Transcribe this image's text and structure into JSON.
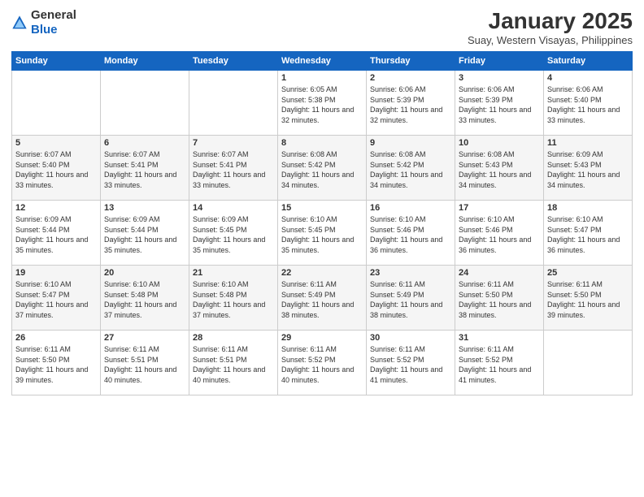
{
  "header": {
    "logo_general": "General",
    "logo_blue": "Blue",
    "month_title": "January 2025",
    "subtitle": "Suay, Western Visayas, Philippines"
  },
  "days_of_week": [
    "Sunday",
    "Monday",
    "Tuesday",
    "Wednesday",
    "Thursday",
    "Friday",
    "Saturday"
  ],
  "weeks": [
    [
      {
        "day": "",
        "sunrise": "",
        "sunset": "",
        "daylight": ""
      },
      {
        "day": "",
        "sunrise": "",
        "sunset": "",
        "daylight": ""
      },
      {
        "day": "",
        "sunrise": "",
        "sunset": "",
        "daylight": ""
      },
      {
        "day": "1",
        "sunrise": "Sunrise: 6:05 AM",
        "sunset": "Sunset: 5:38 PM",
        "daylight": "Daylight: 11 hours and 32 minutes."
      },
      {
        "day": "2",
        "sunrise": "Sunrise: 6:06 AM",
        "sunset": "Sunset: 5:39 PM",
        "daylight": "Daylight: 11 hours and 32 minutes."
      },
      {
        "day": "3",
        "sunrise": "Sunrise: 6:06 AM",
        "sunset": "Sunset: 5:39 PM",
        "daylight": "Daylight: 11 hours and 33 minutes."
      },
      {
        "day": "4",
        "sunrise": "Sunrise: 6:06 AM",
        "sunset": "Sunset: 5:40 PM",
        "daylight": "Daylight: 11 hours and 33 minutes."
      }
    ],
    [
      {
        "day": "5",
        "sunrise": "Sunrise: 6:07 AM",
        "sunset": "Sunset: 5:40 PM",
        "daylight": "Daylight: 11 hours and 33 minutes."
      },
      {
        "day": "6",
        "sunrise": "Sunrise: 6:07 AM",
        "sunset": "Sunset: 5:41 PM",
        "daylight": "Daylight: 11 hours and 33 minutes."
      },
      {
        "day": "7",
        "sunrise": "Sunrise: 6:07 AM",
        "sunset": "Sunset: 5:41 PM",
        "daylight": "Daylight: 11 hours and 33 minutes."
      },
      {
        "day": "8",
        "sunrise": "Sunrise: 6:08 AM",
        "sunset": "Sunset: 5:42 PM",
        "daylight": "Daylight: 11 hours and 34 minutes."
      },
      {
        "day": "9",
        "sunrise": "Sunrise: 6:08 AM",
        "sunset": "Sunset: 5:42 PM",
        "daylight": "Daylight: 11 hours and 34 minutes."
      },
      {
        "day": "10",
        "sunrise": "Sunrise: 6:08 AM",
        "sunset": "Sunset: 5:43 PM",
        "daylight": "Daylight: 11 hours and 34 minutes."
      },
      {
        "day": "11",
        "sunrise": "Sunrise: 6:09 AM",
        "sunset": "Sunset: 5:43 PM",
        "daylight": "Daylight: 11 hours and 34 minutes."
      }
    ],
    [
      {
        "day": "12",
        "sunrise": "Sunrise: 6:09 AM",
        "sunset": "Sunset: 5:44 PM",
        "daylight": "Daylight: 11 hours and 35 minutes."
      },
      {
        "day": "13",
        "sunrise": "Sunrise: 6:09 AM",
        "sunset": "Sunset: 5:44 PM",
        "daylight": "Daylight: 11 hours and 35 minutes."
      },
      {
        "day": "14",
        "sunrise": "Sunrise: 6:09 AM",
        "sunset": "Sunset: 5:45 PM",
        "daylight": "Daylight: 11 hours and 35 minutes."
      },
      {
        "day": "15",
        "sunrise": "Sunrise: 6:10 AM",
        "sunset": "Sunset: 5:45 PM",
        "daylight": "Daylight: 11 hours and 35 minutes."
      },
      {
        "day": "16",
        "sunrise": "Sunrise: 6:10 AM",
        "sunset": "Sunset: 5:46 PM",
        "daylight": "Daylight: 11 hours and 36 minutes."
      },
      {
        "day": "17",
        "sunrise": "Sunrise: 6:10 AM",
        "sunset": "Sunset: 5:46 PM",
        "daylight": "Daylight: 11 hours and 36 minutes."
      },
      {
        "day": "18",
        "sunrise": "Sunrise: 6:10 AM",
        "sunset": "Sunset: 5:47 PM",
        "daylight": "Daylight: 11 hours and 36 minutes."
      }
    ],
    [
      {
        "day": "19",
        "sunrise": "Sunrise: 6:10 AM",
        "sunset": "Sunset: 5:47 PM",
        "daylight": "Daylight: 11 hours and 37 minutes."
      },
      {
        "day": "20",
        "sunrise": "Sunrise: 6:10 AM",
        "sunset": "Sunset: 5:48 PM",
        "daylight": "Daylight: 11 hours and 37 minutes."
      },
      {
        "day": "21",
        "sunrise": "Sunrise: 6:10 AM",
        "sunset": "Sunset: 5:48 PM",
        "daylight": "Daylight: 11 hours and 37 minutes."
      },
      {
        "day": "22",
        "sunrise": "Sunrise: 6:11 AM",
        "sunset": "Sunset: 5:49 PM",
        "daylight": "Daylight: 11 hours and 38 minutes."
      },
      {
        "day": "23",
        "sunrise": "Sunrise: 6:11 AM",
        "sunset": "Sunset: 5:49 PM",
        "daylight": "Daylight: 11 hours and 38 minutes."
      },
      {
        "day": "24",
        "sunrise": "Sunrise: 6:11 AM",
        "sunset": "Sunset: 5:50 PM",
        "daylight": "Daylight: 11 hours and 38 minutes."
      },
      {
        "day": "25",
        "sunrise": "Sunrise: 6:11 AM",
        "sunset": "Sunset: 5:50 PM",
        "daylight": "Daylight: 11 hours and 39 minutes."
      }
    ],
    [
      {
        "day": "26",
        "sunrise": "Sunrise: 6:11 AM",
        "sunset": "Sunset: 5:50 PM",
        "daylight": "Daylight: 11 hours and 39 minutes."
      },
      {
        "day": "27",
        "sunrise": "Sunrise: 6:11 AM",
        "sunset": "Sunset: 5:51 PM",
        "daylight": "Daylight: 11 hours and 40 minutes."
      },
      {
        "day": "28",
        "sunrise": "Sunrise: 6:11 AM",
        "sunset": "Sunset: 5:51 PM",
        "daylight": "Daylight: 11 hours and 40 minutes."
      },
      {
        "day": "29",
        "sunrise": "Sunrise: 6:11 AM",
        "sunset": "Sunset: 5:52 PM",
        "daylight": "Daylight: 11 hours and 40 minutes."
      },
      {
        "day": "30",
        "sunrise": "Sunrise: 6:11 AM",
        "sunset": "Sunset: 5:52 PM",
        "daylight": "Daylight: 11 hours and 41 minutes."
      },
      {
        "day": "31",
        "sunrise": "Sunrise: 6:11 AM",
        "sunset": "Sunset: 5:52 PM",
        "daylight": "Daylight: 11 hours and 41 minutes."
      },
      {
        "day": "",
        "sunrise": "",
        "sunset": "",
        "daylight": ""
      }
    ]
  ]
}
